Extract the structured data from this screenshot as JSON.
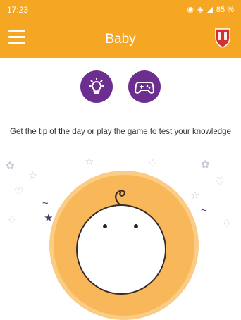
{
  "status_bar": {
    "time": "17:23",
    "battery": "85 %"
  },
  "app_bar": {
    "title": "Baby"
  },
  "actions": {
    "tip_icon": "lightbulb-icon",
    "game_icon": "gamepad-icon"
  },
  "prompt_text": "Get the tip of the day or play the game to test your knowledge",
  "colors": {
    "primary": "#f5a623",
    "accent": "#6d2f8f",
    "baby_circle": "#f8b85a"
  }
}
